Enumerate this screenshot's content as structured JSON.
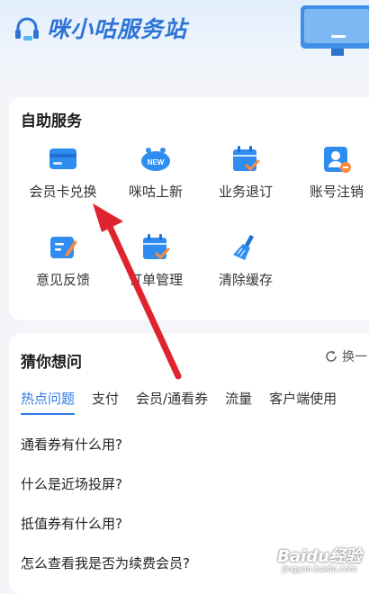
{
  "header": {
    "title": "咪小咕服务站"
  },
  "self_service": {
    "title": "自助服务",
    "items": [
      {
        "label": "会员卡兑换",
        "icon": "card-icon"
      },
      {
        "label": "咪咕上新",
        "icon": "new-mascot-icon"
      },
      {
        "label": "业务退订",
        "icon": "calendar-check-icon"
      },
      {
        "label": "账号注销",
        "icon": "user-remove-icon"
      },
      {
        "label": "意见反馈",
        "icon": "feedback-edit-icon"
      },
      {
        "label": "订单管理",
        "icon": "calendar-order-icon"
      },
      {
        "label": "清除缓存",
        "icon": "broom-icon"
      }
    ]
  },
  "guess": {
    "title": "猜你想问",
    "refresh_label": "换一",
    "tabs": [
      "热点问题",
      "支付",
      "会员/通看券",
      "流量",
      "客户端使用"
    ],
    "active_tab": 0,
    "questions": [
      "通看券有什么用?",
      "什么是近场投屏?",
      "抵值券有什么用?",
      "怎么查看我是否为续费会员?"
    ]
  },
  "watermark": {
    "main": "Baidu经验",
    "sub": "jingyan.baidu.com"
  },
  "colors": {
    "accent": "#2f7ae5",
    "annotation_arrow": "#e0242f"
  }
}
